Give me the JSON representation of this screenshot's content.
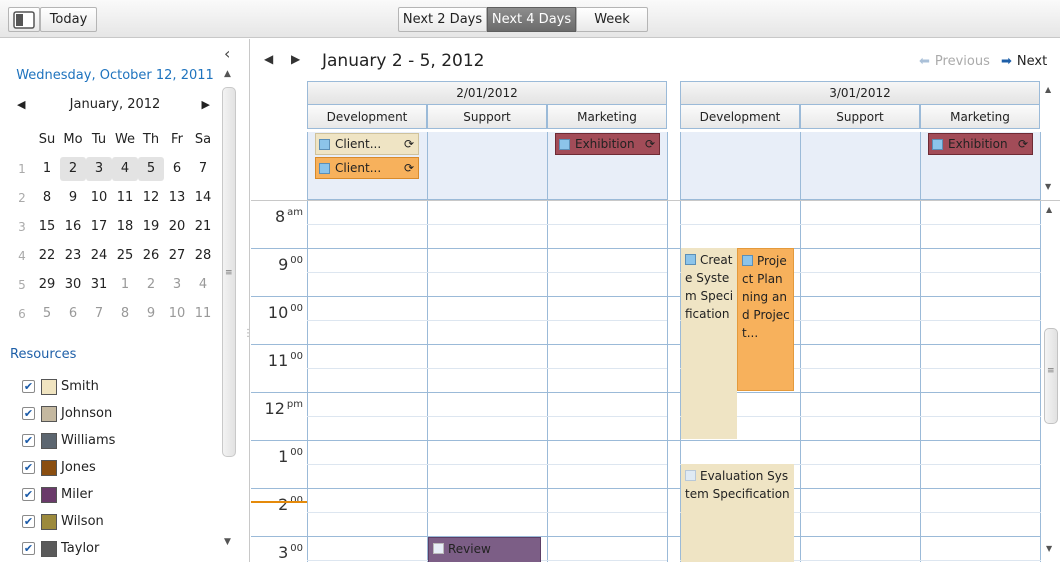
{
  "toolbar": {
    "today_label": "Today",
    "views": [
      {
        "label": "Next 2 Days",
        "active": false
      },
      {
        "label": "Next 4 Days",
        "active": true
      },
      {
        "label": "Week",
        "active": false
      }
    ]
  },
  "sidebar": {
    "collapse_icon": "chevron-left-icon",
    "today_text": "Wednesday, October 12, 2011",
    "mini_calendar": {
      "month_label": "January, 2012",
      "weekday_headers": [
        "Su",
        "Mo",
        "Tu",
        "We",
        "Th",
        "Fr",
        "Sa"
      ],
      "weeks": [
        {
          "week": "1",
          "days": [
            "1",
            "2",
            "3",
            "4",
            "5",
            "6",
            "7"
          ],
          "dim": [
            false,
            false,
            false,
            false,
            false,
            false,
            false
          ],
          "selected": [
            false,
            true,
            true,
            true,
            true,
            false,
            false
          ]
        },
        {
          "week": "2",
          "days": [
            "8",
            "9",
            "10",
            "11",
            "12",
            "13",
            "14"
          ],
          "dim": [
            false,
            false,
            false,
            false,
            false,
            false,
            false
          ],
          "selected": [
            false,
            false,
            false,
            false,
            false,
            false,
            false
          ]
        },
        {
          "week": "3",
          "days": [
            "15",
            "16",
            "17",
            "18",
            "19",
            "20",
            "21"
          ],
          "dim": [
            false,
            false,
            false,
            false,
            false,
            false,
            false
          ],
          "selected": [
            false,
            false,
            false,
            false,
            false,
            false,
            false
          ]
        },
        {
          "week": "4",
          "days": [
            "22",
            "23",
            "24",
            "25",
            "26",
            "27",
            "28"
          ],
          "dim": [
            false,
            false,
            false,
            false,
            false,
            false,
            false
          ],
          "selected": [
            false,
            false,
            false,
            false,
            false,
            false,
            false
          ]
        },
        {
          "week": "5",
          "days": [
            "29",
            "30",
            "31",
            "1",
            "2",
            "3",
            "4"
          ],
          "dim": [
            false,
            false,
            false,
            true,
            true,
            true,
            true
          ],
          "selected": [
            false,
            false,
            false,
            false,
            false,
            false,
            false
          ]
        },
        {
          "week": "6",
          "days": [
            "5",
            "6",
            "7",
            "8",
            "9",
            "10",
            "11"
          ],
          "dim": [
            true,
            true,
            true,
            true,
            true,
            true,
            true
          ],
          "selected": [
            false,
            false,
            false,
            false,
            false,
            false,
            false
          ]
        }
      ]
    },
    "resources_title": "Resources",
    "resources": [
      {
        "name": "Smith",
        "color": "#f0e4c0",
        "checked": true
      },
      {
        "name": "Johnson",
        "color": "#c4b8a0",
        "checked": true
      },
      {
        "name": "Williams",
        "color": "#5c6670",
        "checked": true
      },
      {
        "name": "Jones",
        "color": "#8a4e10",
        "checked": true
      },
      {
        "name": "Miler",
        "color": "#6a3a6a",
        "checked": true
      },
      {
        "name": "Wilson",
        "color": "#9c8a3c",
        "checked": true
      },
      {
        "name": "Taylor",
        "color": "#5a5a5a",
        "checked": true
      }
    ]
  },
  "main": {
    "range_title": "January 2 - 5, 2012",
    "prev_label": "Previous",
    "next_label": "Next",
    "days": [
      {
        "date": "2/01/2012",
        "resources": [
          "Development",
          "Support",
          "Marketing"
        ]
      },
      {
        "date": "3/01/2012",
        "resources": [
          "Development",
          "Support",
          "Marketing"
        ]
      }
    ],
    "all_day_events": [
      {
        "day": 0,
        "col": 0,
        "row": 0,
        "title": "Client...",
        "color": "#efe4c4",
        "recurring": true
      },
      {
        "day": 0,
        "col": 0,
        "row": 1,
        "title": "Client...",
        "color": "#f7b15c",
        "recurring": true
      },
      {
        "day": 0,
        "col": 2,
        "row": 0,
        "title": "Exhibition",
        "color": "#a24c58",
        "recurring": true
      },
      {
        "day": 1,
        "col": 2,
        "row": 0,
        "title": "Exhibition",
        "color": "#a24c58",
        "recurring": true
      }
    ],
    "hours": [
      {
        "hour": "8",
        "suffix": "am"
      },
      {
        "hour": "9",
        "suffix": "00"
      },
      {
        "hour": "10",
        "suffix": "00"
      },
      {
        "hour": "11",
        "suffix": "00"
      },
      {
        "hour": "12",
        "suffix": "pm"
      },
      {
        "hour": "1",
        "suffix": "00"
      },
      {
        "hour": "2",
        "suffix": "00"
      },
      {
        "hour": "3",
        "suffix": "00"
      }
    ],
    "timed_events": [
      {
        "id": "create-system-spec",
        "title": "Create System Specification",
        "color": "#efe4c4",
        "border": "#e2d4ae"
      },
      {
        "id": "project-planning",
        "title": "Project Planning and Project...",
        "color": "#f7b15c",
        "border": "#e49a3c"
      },
      {
        "id": "evaluation-spec",
        "title": "Evaluation System Specification",
        "color": "#efe4c4",
        "border": "#e2d4ae"
      },
      {
        "id": "review",
        "title": "Review",
        "color": "#7c5e86",
        "border": "#5c3e66"
      }
    ]
  }
}
